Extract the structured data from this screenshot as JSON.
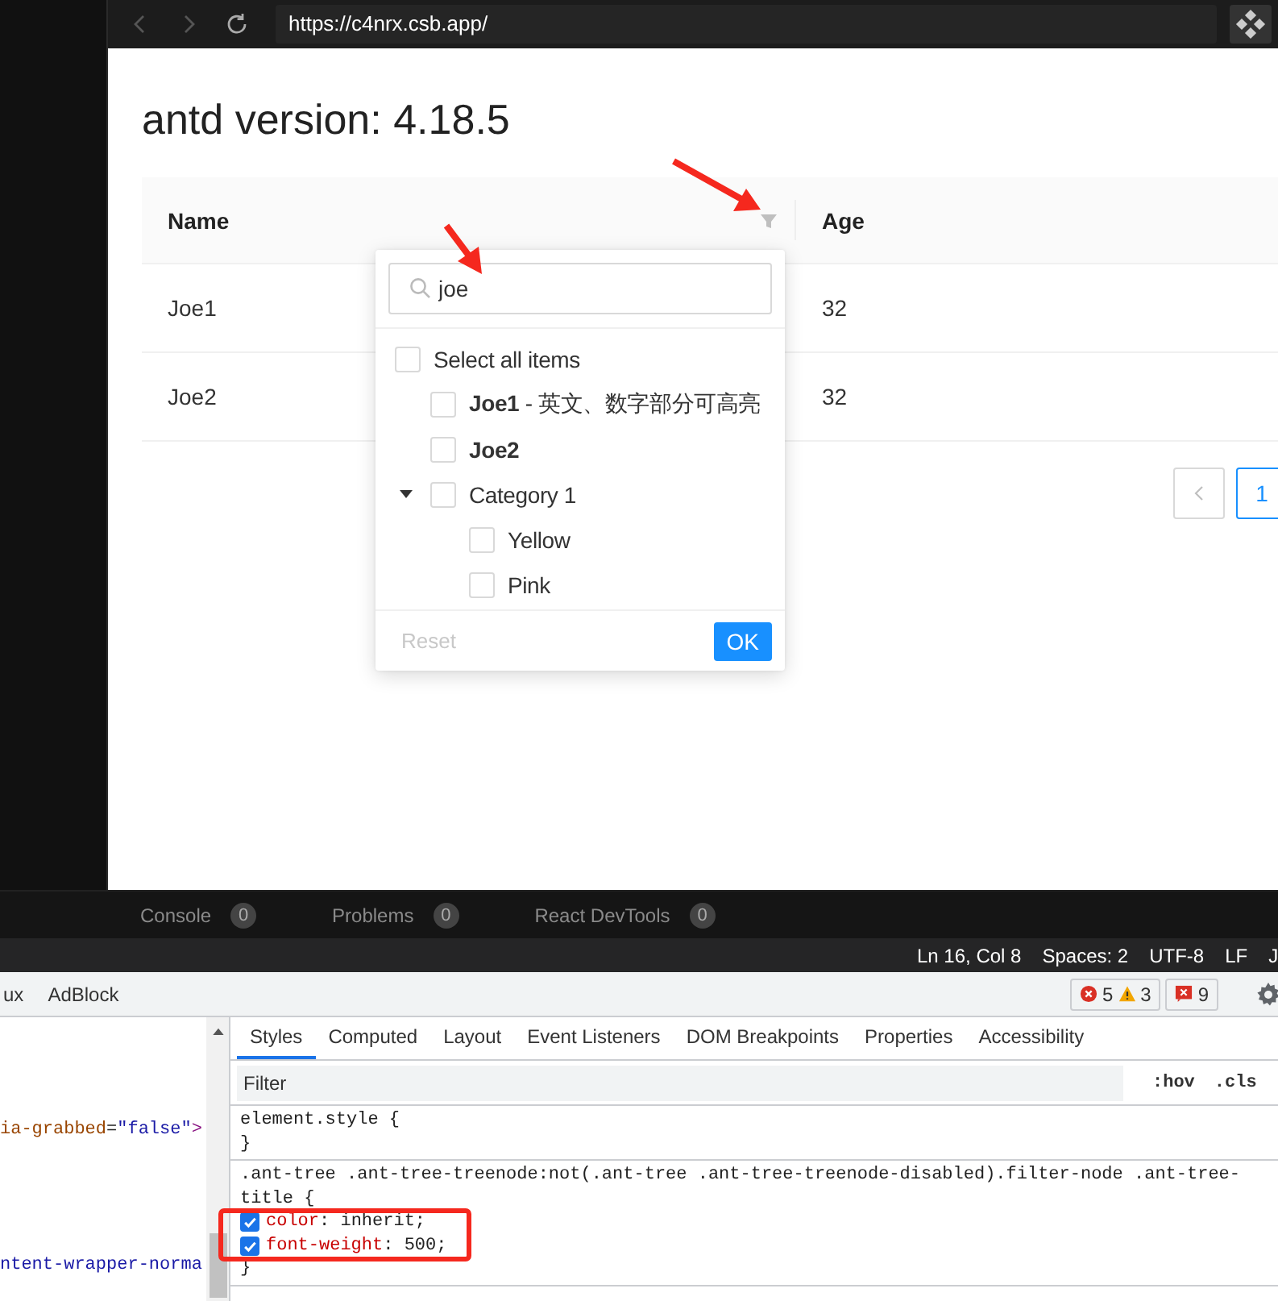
{
  "browser": {
    "url": "https://c4nrx.csb.app/"
  },
  "page": {
    "heading": "antd version: 4.18.5"
  },
  "table": {
    "columns": [
      {
        "title": "Name",
        "filter": true
      },
      {
        "title": "Age",
        "filter": false
      }
    ],
    "rows": [
      [
        "Joe1",
        "32"
      ],
      [
        "Joe2",
        "32"
      ]
    ],
    "pagination": {
      "prev": {
        "disabled": true
      },
      "pages": [
        {
          "label": "1",
          "selected": true
        }
      ]
    }
  },
  "filter_dropdown": {
    "search": {
      "value": "joe"
    },
    "select_all": {
      "label": "Select all items",
      "checked": false
    },
    "tree": [
      {
        "title": "**Joe1** - 英文、数字部分可高亮",
        "checked": false,
        "highlighted": false
      },
      {
        "title": "Joe2",
        "checked": false,
        "highlighted": true
      },
      {
        "title": "Category 1",
        "checked": false,
        "highlighted": false,
        "expanded": true,
        "children": [
          {
            "title": "Yellow",
            "checked": false,
            "highlighted": false
          },
          {
            "title": "Pink",
            "checked": false,
            "highlighted": false
          }
        ]
      }
    ],
    "reset": {
      "label": "Reset",
      "disabled": true
    },
    "ok": {
      "label": "OK"
    }
  },
  "bottom_tabs": [
    {
      "label": "Console",
      "count": "0"
    },
    {
      "label": "Problems",
      "count": "0"
    },
    {
      "label": "React DevTools",
      "count": "0"
    }
  ],
  "status_bar": [
    "Ln 16, Col 8",
    "Spaces: 2",
    "UTF-8",
    "LF",
    "J"
  ],
  "devtools": {
    "tabs": [
      {
        "label": "ux"
      },
      {
        "label": "AdBlock"
      }
    ],
    "errors": "5",
    "warnings": "3",
    "issues": "9",
    "elements_lines": [
      [
        {
          "kind": "attr-name",
          "text": "ia-grabbed"
        },
        {
          "kind": "punct",
          "text": "="
        },
        {
          "kind": "attr-value",
          "text": "\"false\""
        },
        {
          "kind": "tag",
          "text": ">"
        }
      ],
      [
        {
          "kind": "attr-value",
          "text": "ntent-wrapper-norma"
        }
      ]
    ],
    "style_tabs": [
      {
        "label": "Styles",
        "selected": true
      },
      {
        "label": "Computed",
        "selected": false
      },
      {
        "label": "Layout",
        "selected": false
      },
      {
        "label": "Event Listeners",
        "selected": false
      },
      {
        "label": "DOM Breakpoints",
        "selected": false
      },
      {
        "label": "Properties",
        "selected": false
      },
      {
        "label": "Accessibility",
        "selected": false
      }
    ],
    "filter": {
      "placeholder": "Filter"
    },
    "toggles": [
      ":hov",
      ".cls"
    ],
    "rules": [
      {
        "selector": "element.style {",
        "close": "}"
      },
      {
        "selector": ".ant-tree .ant-tree-treenode:not(.ant-tree .ant-tree-treenode-disabled).filter-node .ant-tree-title {",
        "close": "}",
        "properties": [
          {
            "name": "color",
            "value": ": inherit;",
            "checked": true
          },
          {
            "name": "font-weight",
            "value": ": 500;",
            "checked": true
          }
        ]
      }
    ]
  }
}
